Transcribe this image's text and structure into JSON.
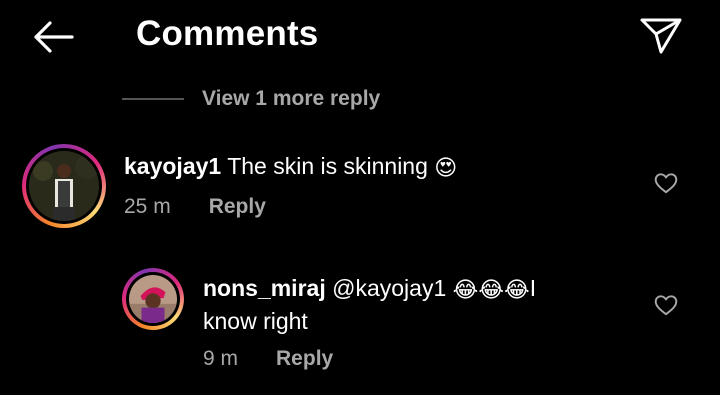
{
  "header": {
    "title": "Comments",
    "back_icon": "arrow-left-icon",
    "send_icon": "paper-plane-icon"
  },
  "thread": {
    "view_more_label": "View 1 more reply"
  },
  "comments": [
    {
      "username": "kayojay1",
      "text": "The skin is skinning",
      "emoji": "😍",
      "time": "25 m",
      "reply_label": "Reply",
      "like_icon": "heart-outline-icon"
    },
    {
      "username": "nons_miraj",
      "mention": "@kayojay1",
      "emoji": "😂😂😂",
      "text_after": "I know right",
      "time": "9 m",
      "reply_label": "Reply",
      "like_icon": "heart-outline-icon"
    }
  ],
  "colors": {
    "background": "#000000",
    "secondary_text": "#a8a8a8",
    "story_ring": "#dd2a7b"
  }
}
